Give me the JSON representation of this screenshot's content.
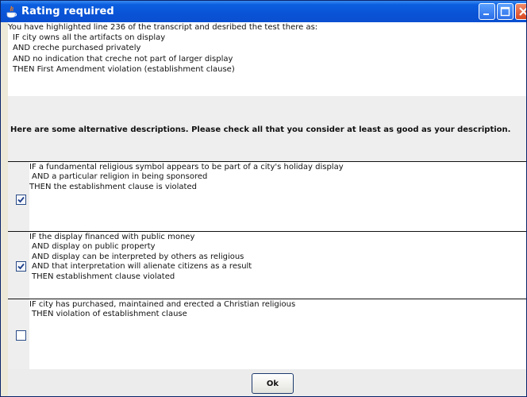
{
  "window": {
    "title": "Rating required",
    "icons": [
      "java-icon",
      "minimize-icon",
      "maximize-icon",
      "close-icon"
    ]
  },
  "header": {
    "lines": [
      "You have highlighted line 236 of the transcript and desribed the test there as:",
      "IF city owns all the artifacts on display",
      "AND creche purchased privately",
      "AND no indication that creche not part of larger display",
      "THEN First Amendment violation (establishment clause)"
    ]
  },
  "prompt": "Here are some alternative descriptions. Please check all that you consider at least as good as your description.",
  "options": [
    {
      "checked": true,
      "lines": [
        "IF a fundamental religious symbol appears to be part of a city's holiday display",
        "AND a particular religion in being sponsored",
        "THEN the establishment clause is violated"
      ]
    },
    {
      "checked": true,
      "lines": [
        "IF the display financed with public money",
        "AND display on public property",
        "AND display can be interpreted by others as religious",
        "AND that interpretation will alienate citizens as a result",
        "THEN establishment clause violated"
      ]
    },
    {
      "checked": false,
      "lines": [
        "IF city has purchased, maintained and erected a Christian religious",
        "THEN violation of establishment clause"
      ]
    }
  ],
  "buttons": {
    "ok": "Ok"
  },
  "colors": {
    "titlebar": "#0a53d6",
    "panel": "#eeeeee",
    "border": "#111111"
  }
}
